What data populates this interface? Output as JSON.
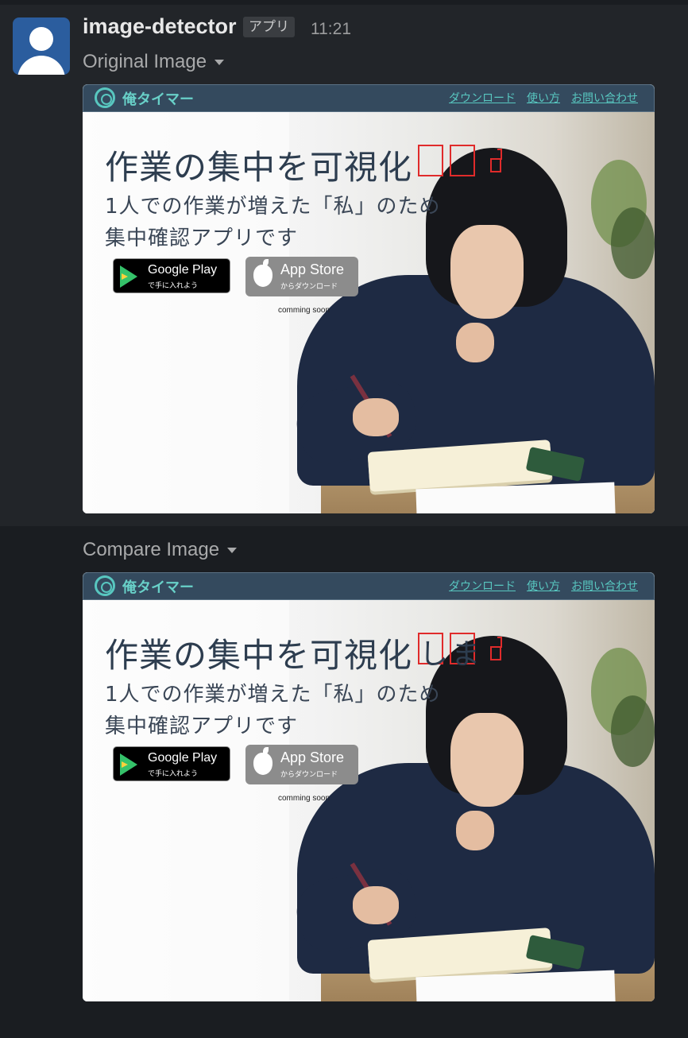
{
  "message": {
    "sender": "image-detector",
    "badge": "アプリ",
    "time": "11:21"
  },
  "sections": [
    {
      "label": "Original Image",
      "highlighted_chars": [
        "",
        ""
      ]
    },
    {
      "label": "Compare Image",
      "highlighted_chars": [
        "し",
        "ま"
      ]
    }
  ],
  "site": {
    "brand": "俺タイマー",
    "nav": [
      "ダウンロード",
      "使い方",
      "お問い合わせ"
    ],
    "headline": "作業の集中を可視化",
    "sub1": "1人での作業が増えた「私」のため",
    "sub2": "集中確認アプリです",
    "google_play": {
      "title": "Google Play",
      "sub": "で手に入れよう"
    },
    "app_store": {
      "title": "App Store",
      "sub": "からダウンロード"
    },
    "coming_soon": "comming soon"
  },
  "colors": {
    "highlight": "#e02b2b",
    "nav_bg": "#344a5e",
    "brand": "#58c7c0"
  }
}
